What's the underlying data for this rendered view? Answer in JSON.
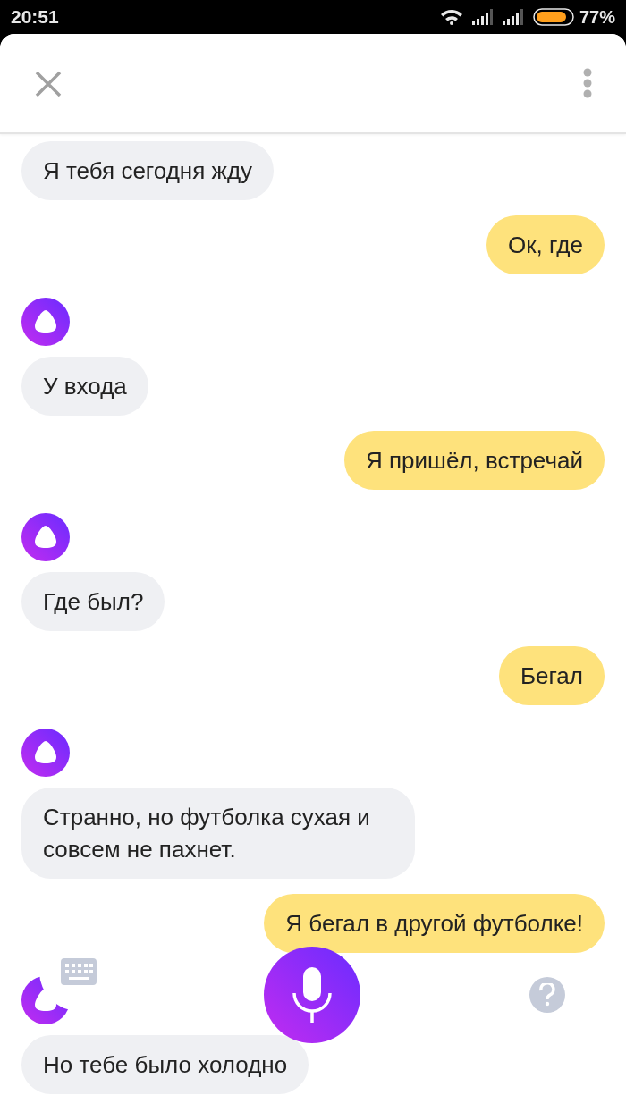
{
  "status_bar": {
    "time": "20:51",
    "battery": "77%"
  },
  "messages": [
    {
      "kind": "assistant",
      "avatar": false,
      "text": "Я тебя сегодня жду"
    },
    {
      "kind": "user",
      "text": "Ок, где"
    },
    {
      "kind": "assistant",
      "avatar": true,
      "text": "У входа"
    },
    {
      "kind": "user",
      "text": "Я пришёл, встречай"
    },
    {
      "kind": "assistant",
      "avatar": true,
      "text": "Где был?"
    },
    {
      "kind": "user",
      "text": "Бегал"
    },
    {
      "kind": "assistant",
      "avatar": true,
      "text": "Странно, но футболка сухая и совсем не пахнет."
    },
    {
      "kind": "user",
      "text": "Я бегал в другой футболке!"
    },
    {
      "kind": "assistant",
      "avatar": true,
      "text": "Но тебе было холодно"
    }
  ]
}
